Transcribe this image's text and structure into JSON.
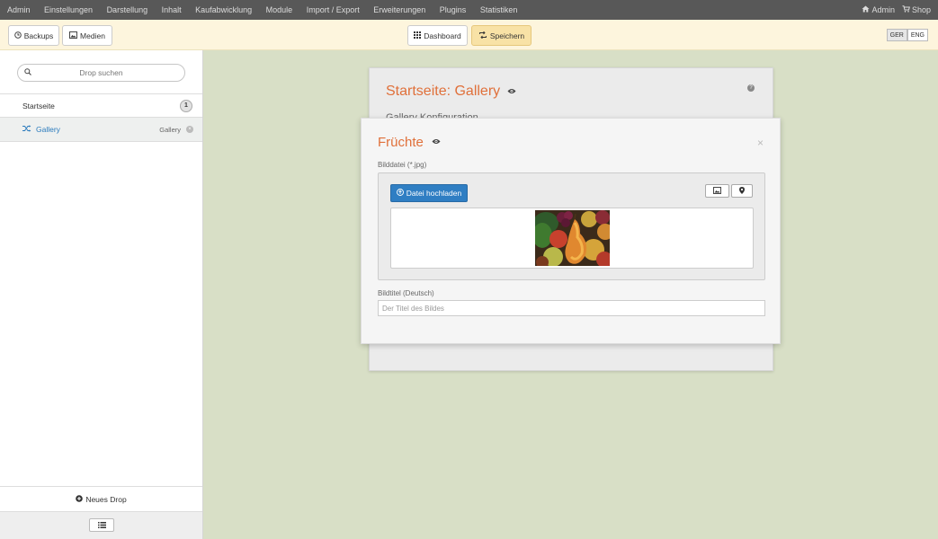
{
  "topnav": {
    "menu": [
      "Admin",
      "Einstellungen",
      "Darstellung",
      "Inhalt",
      "Kaufabwicklung",
      "Module",
      "Import / Export",
      "Erweiterungen",
      "Plugins",
      "Statistiken"
    ],
    "admin_link": "Admin",
    "shop_link": "Shop"
  },
  "toolbar": {
    "backups_label": "Backups",
    "medien_label": "Medien",
    "dashboard_label": "Dashboard",
    "save_label": "Speichern",
    "lang_ger": "GER",
    "lang_eng": "ENG"
  },
  "sidebar": {
    "search_placeholder": "Drop suchen",
    "items": [
      {
        "label": "Startseite",
        "badge": "1"
      },
      {
        "label": "Gallery",
        "type": "Gallery"
      }
    ],
    "new_drop_label": "Neues Drop"
  },
  "panel": {
    "title": "Startseite: Gallery",
    "subtitle": "Gallery Konfiguration"
  },
  "modal": {
    "title": "Früchte",
    "image_label": "Bilddatei (*.jpg)",
    "upload_label": "Datei hochladen",
    "title_field_label": "Bildtitel (Deutsch)",
    "title_field_placeholder": "Der Titel des Bildes"
  },
  "colors": {
    "accent_orange": "#e0703a",
    "primary_blue": "#2f7ec3",
    "toolbar_bg": "#fdf5dd",
    "nav_bg": "#585858",
    "workspace_bg": "#d8dfc6"
  }
}
